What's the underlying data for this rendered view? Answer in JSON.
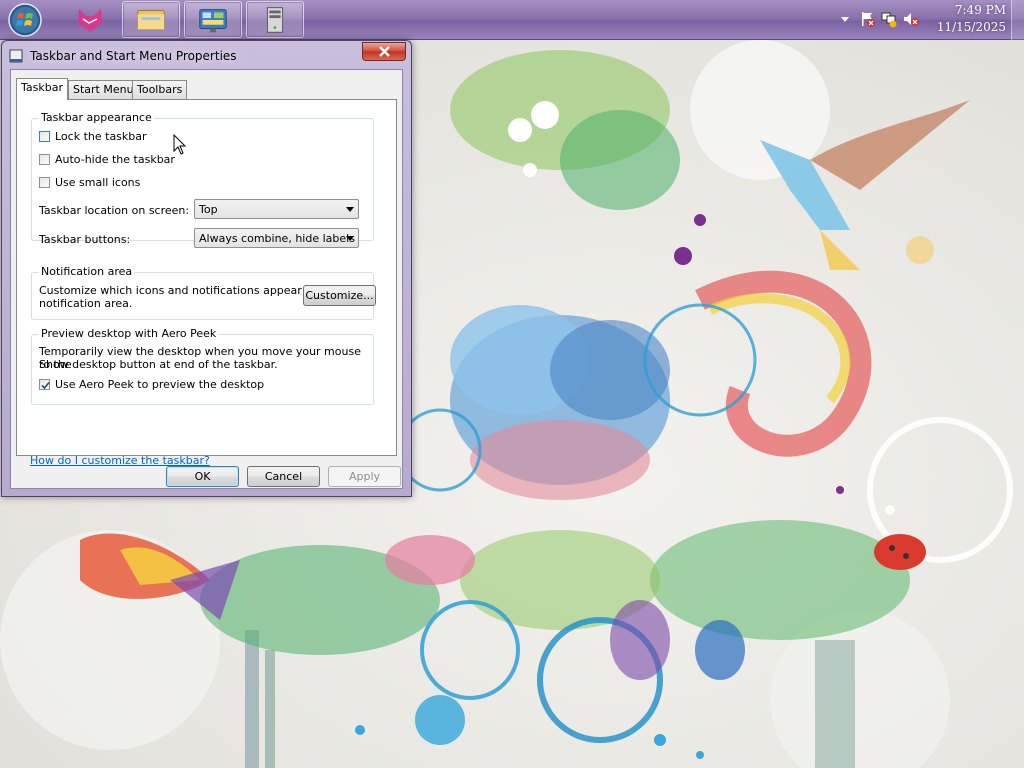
{
  "taskbar": {
    "start_icon": "windows-orb",
    "pinned": [
      {
        "name": "fox-app-icon"
      },
      {
        "name": "explorer-icon"
      },
      {
        "name": "control-panel-icon"
      },
      {
        "name": "server-icon"
      }
    ],
    "clock": {
      "time": "7:49 PM",
      "date": "11/15/2025"
    },
    "tray_icons": [
      "show-hidden-arrow-icon",
      "action-center-flag-icon",
      "network-icon",
      "volume-muted-icon"
    ]
  },
  "dialog": {
    "title": "Taskbar and Start Menu Properties",
    "tabs": [
      {
        "label": "Taskbar",
        "active": true
      },
      {
        "label": "Start Menu",
        "active": false
      },
      {
        "label": "Toolbars",
        "active": false
      }
    ],
    "appearance": {
      "heading": "Taskbar appearance",
      "lock": {
        "label": "Lock the taskbar",
        "checked": false
      },
      "autohide": {
        "label": "Auto-hide the taskbar",
        "checked": false
      },
      "small_icons": {
        "label": "Use small icons",
        "checked": false
      },
      "location": {
        "label": "Taskbar location on screen:",
        "value": "Top"
      },
      "buttons": {
        "label": "Taskbar buttons:",
        "value": "Always combine, hide labels"
      }
    },
    "notification": {
      "heading": "Notification area",
      "description_line1": "Customize which icons and notifications appear in the",
      "description_line2": "notification area.",
      "customize_label": "Customize..."
    },
    "aero_peek": {
      "heading": "Preview desktop with Aero Peek",
      "description_line1": "Temporarily view the desktop when you move your mouse to the",
      "description_line2": "Show desktop button at end of the taskbar.",
      "checkbox": {
        "label": "Use Aero Peek to preview the desktop",
        "checked": true
      }
    },
    "help_link": "How do I customize the taskbar?",
    "buttons": {
      "ok": "OK",
      "cancel": "Cancel",
      "apply": "Apply"
    }
  },
  "colors": {
    "link": "#0066cc",
    "taskbar": "#8a73ad",
    "dialog_frame": "#b7aacd"
  }
}
